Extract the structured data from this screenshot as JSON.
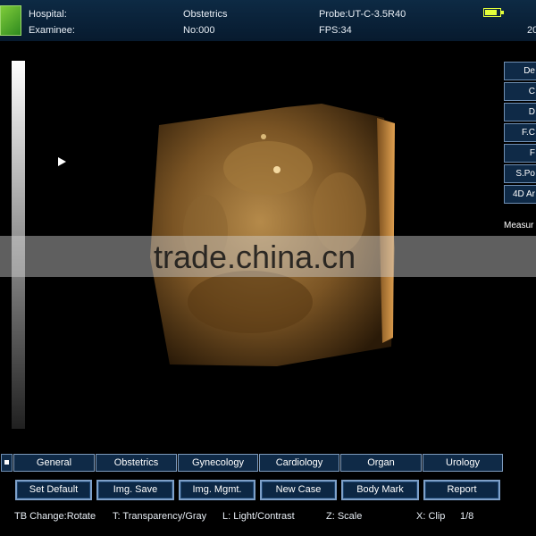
{
  "header": {
    "hospital_label": "Hospital:",
    "examinee_label": "Examinee:",
    "exam_type": "Obstetrics",
    "exam_no": "No:000",
    "probe": "Probe:UT-C-3.5R40",
    "fps": "FPS:34",
    "date_fragment": "20",
    "battery_level": 0.8
  },
  "side_menu": {
    "items": [
      "De",
      "C",
      "D",
      "F.C",
      "F",
      "S.Po",
      "4D Ar"
    ],
    "measure_label": "Measur"
  },
  "watermark": "trade.china.cn",
  "tabs": [
    "General",
    "Obstetrics",
    "Gynecology",
    "Cardiology",
    "Organ",
    "Urology"
  ],
  "buttons": [
    "Set Default",
    "Img. Save",
    "Img. Mgmt.",
    "New Case",
    "Body Mark",
    "Report"
  ],
  "status": {
    "rotate": "TB Change:Rotate",
    "transparency": "T: Transparency/Gray",
    "light": "L: Light/Contrast",
    "scale": "Z: Scale",
    "clip": "X: Clip",
    "page": "1/8"
  },
  "colors": {
    "header_bg": "#0d2a44",
    "button_bg": "#0c2744",
    "button_border": "#7ea0c8",
    "battery": "#e4ff3a",
    "render_tint": "#b07a30"
  }
}
